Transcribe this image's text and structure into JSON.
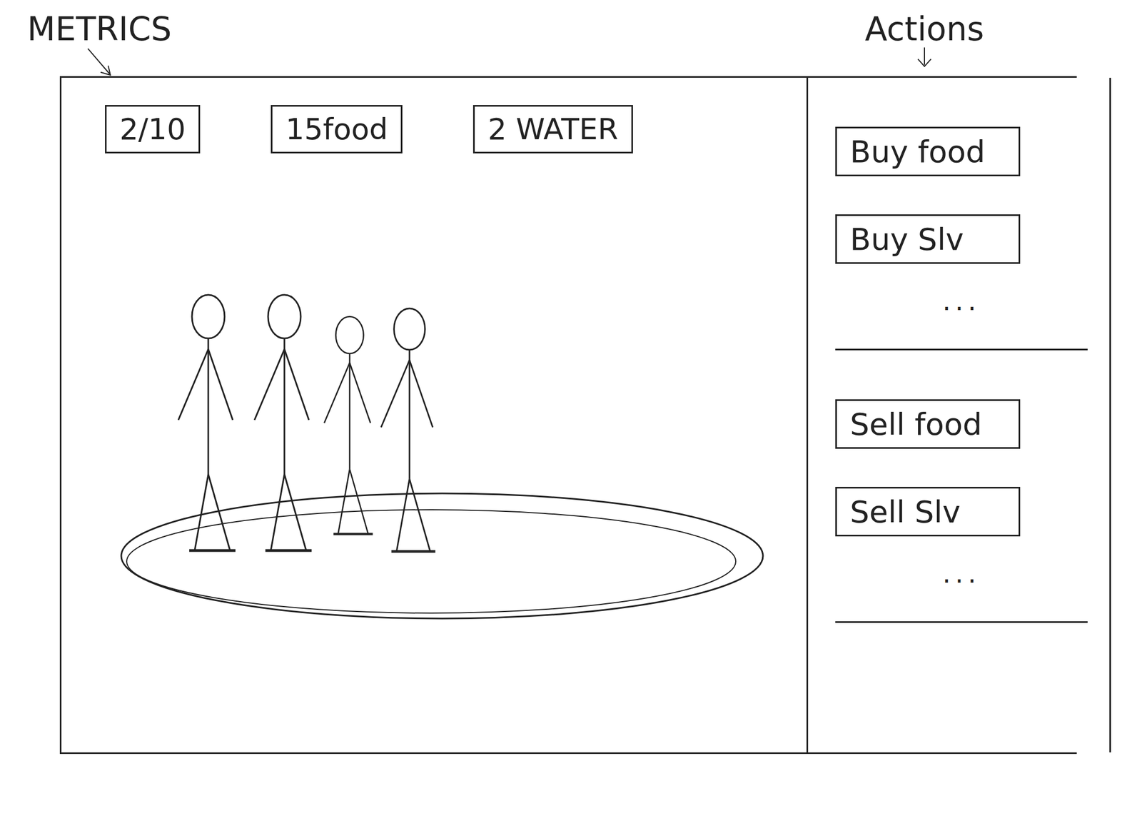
{
  "annotations": {
    "metrics": "METRICS",
    "actions": "Actions"
  },
  "metrics": [
    {
      "label": "2/10"
    },
    {
      "label": "15food"
    },
    {
      "label": "2 WATER"
    }
  ],
  "action_groups": [
    {
      "items": [
        {
          "label": "Buy food"
        },
        {
          "label": "Buy Slv"
        }
      ],
      "more": "..."
    },
    {
      "items": [
        {
          "label": "Sell food"
        },
        {
          "label": "Sell Slv"
        }
      ],
      "more": "..."
    }
  ]
}
